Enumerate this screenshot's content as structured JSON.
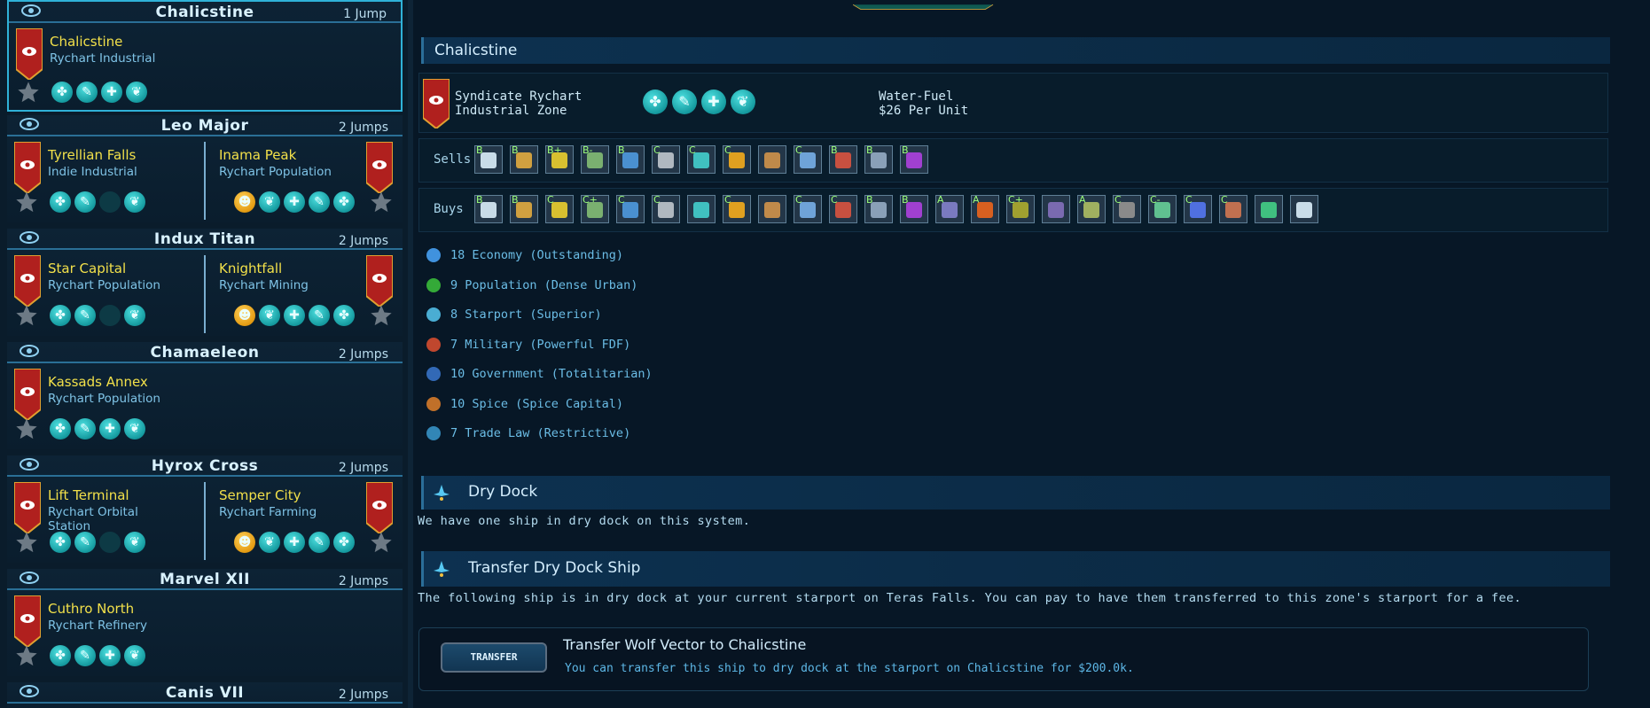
{
  "systems": [
    {
      "name": "Chalicstine",
      "jumps": "1 Jump",
      "zones": [
        {
          "name": "Chalicstine",
          "type": "Rychart Industrial"
        }
      ]
    },
    {
      "name": "Leo Major",
      "jumps": "2 Jumps",
      "zones": [
        {
          "name": "Tyrellian Falls",
          "type": "Indie Industrial"
        },
        {
          "name": "Inama Peak",
          "type": "Rychart Population"
        }
      ]
    },
    {
      "name": "Indux Titan",
      "jumps": "2 Jumps",
      "zones": [
        {
          "name": "Star Capital",
          "type": "Rychart Population"
        },
        {
          "name": "Knightfall",
          "type": "Rychart Mining"
        }
      ]
    },
    {
      "name": "Chamaeleon",
      "jumps": "2 Jumps",
      "zones": [
        {
          "name": "Kassads Annex",
          "type": "Rychart Population"
        }
      ]
    },
    {
      "name": "Hyrox Cross",
      "jumps": "2 Jumps",
      "zones": [
        {
          "name": "Lift Terminal",
          "type": "Rychart Orbital Station"
        },
        {
          "name": "Semper City",
          "type": "Rychart Farming"
        }
      ]
    },
    {
      "name": "Marvel XII",
      "jumps": "2 Jumps",
      "zones": [
        {
          "name": "Cuthro North",
          "type": "Rychart Refinery"
        }
      ]
    },
    {
      "name": "Canis VII",
      "jumps": "2 Jumps"
    }
  ],
  "detail": {
    "title": "Chalicstine",
    "faction_line1": "Syndicate Rychart",
    "faction_line2": "Industrial Zone",
    "fuel_line1": "Water-Fuel",
    "fuel_line2": "$26 Per Unit",
    "sells_label": "Sells",
    "buys_label": "Buys",
    "sells": [
      "B",
      "B",
      "B+",
      "B-",
      "B",
      "C",
      "C",
      "C",
      "",
      "C",
      "B",
      "B",
      "B"
    ],
    "buys": [
      "B",
      "B",
      "C",
      "C+",
      "C",
      "C",
      "",
      "C",
      "",
      "C",
      "C",
      "B",
      "B",
      "A",
      "A",
      "C+",
      "",
      "A",
      "C",
      "C-",
      "C",
      "C",
      "",
      ""
    ],
    "stats": [
      {
        "text": "18 Economy (Outstanding)",
        "icon": "economy-icon"
      },
      {
        "text": "9 Population (Dense Urban)",
        "icon": "population-icon"
      },
      {
        "text": "8 Starport (Superior)",
        "icon": "starport-icon"
      },
      {
        "text": "7 Military (Powerful FDF)",
        "icon": "military-icon"
      },
      {
        "text": "10 Government (Totalitarian)",
        "icon": "government-icon"
      },
      {
        "text": "10 Spice (Spice Capital)",
        "icon": "spice-icon"
      },
      {
        "text": "7 Trade Law (Restrictive)",
        "icon": "trade-law-icon"
      }
    ],
    "drydock_title": "Dry Dock",
    "drydock_text": "We have one ship in dry dock on this system.",
    "transfer_title": "Transfer Dry Dock Ship",
    "transfer_text": "The following ship is in dry dock at your current starport on Teras Falls. You can pay to have them transferred to this zone's starport for a fee.",
    "card_button": "TRANSFER",
    "card_title": "Transfer Wolf Vector to Chalicstine",
    "card_text": "You can transfer this ship to dry dock at the starport on Chalicstine for $200.0k."
  },
  "colors": {
    "accent": "#2fb2d8",
    "zone_name": "#f2e04a",
    "panel": "#0a1c2b"
  }
}
